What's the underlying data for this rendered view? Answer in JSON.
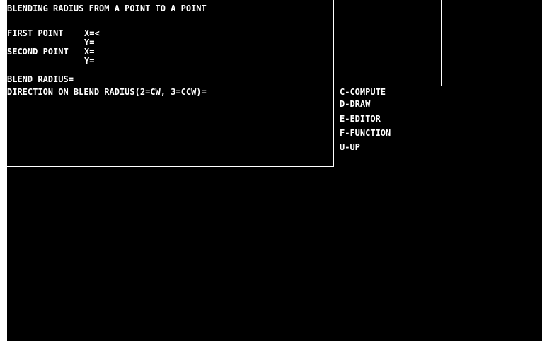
{
  "title": "BLENDING RADIUS FROM A POINT TO A POINT",
  "first_point": {
    "label": "FIRST POINT",
    "x_label": "X=<",
    "y_label": "Y="
  },
  "second_point": {
    "label": "SECOND POINT",
    "x_label": "X=",
    "y_label": "Y="
  },
  "blend_radius_label": "BLEND RADIUS=",
  "direction_label": "DIRECTION ON BLEND RADIUS(2=CW, 3=CCW)=",
  "menu": {
    "items": [
      {
        "label": "C-COMPUTE"
      },
      {
        "label": "D-DRAW"
      },
      {
        "label": "E-EDITOR"
      },
      {
        "label": "F-FUNCTION"
      },
      {
        "label": "U-UP"
      }
    ]
  },
  "colors": {
    "background": "#000000",
    "foreground": "#ffffff"
  }
}
